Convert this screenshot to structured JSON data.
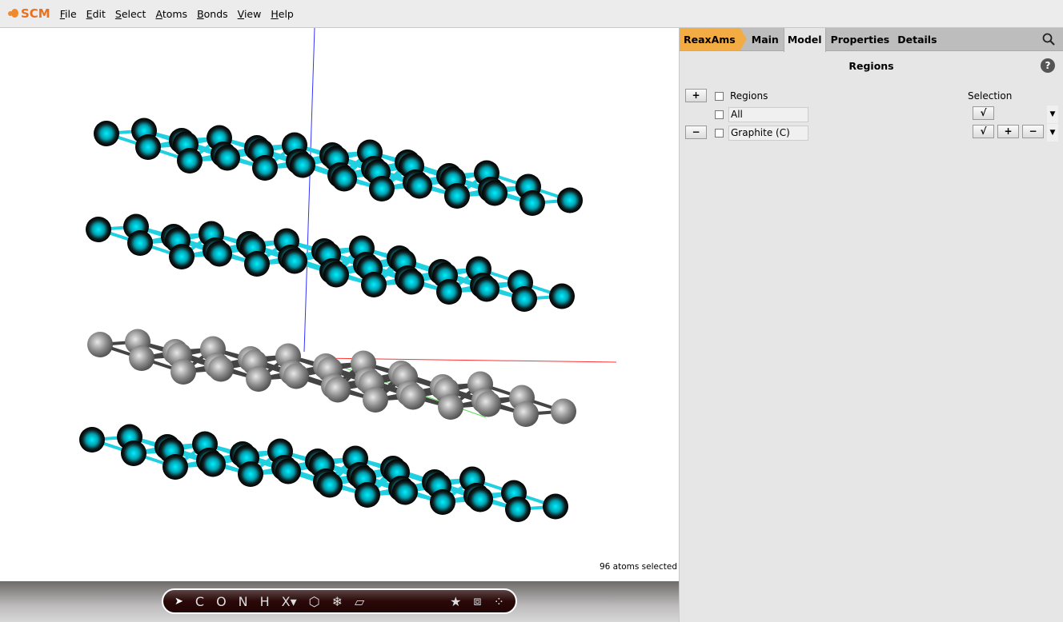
{
  "menubar": {
    "logo": "SCM",
    "items": [
      "File",
      "Edit",
      "Select",
      "Atoms",
      "Bonds",
      "View",
      "Help"
    ]
  },
  "viewer": {
    "status": "96 atoms selected",
    "colors": {
      "selected_atom": "#00e5f0",
      "atom": "#9a9a9a",
      "x_axis": "#ff0000",
      "y_axis": "#00cc00",
      "z_axis": "#0000ff"
    }
  },
  "toolbar": {
    "tools": [
      {
        "icon": "pointer-icon",
        "label": "➤"
      },
      {
        "icon": "carbon",
        "label": "C"
      },
      {
        "icon": "oxygen",
        "label": "O"
      },
      {
        "icon": "nitrogen",
        "label": "N"
      },
      {
        "icon": "hydrogen",
        "label": "H"
      },
      {
        "icon": "other-element",
        "label": "X▾"
      },
      {
        "icon": "hexagon-icon",
        "label": "⬡"
      },
      {
        "icon": "snowflake-icon",
        "label": "❄"
      },
      {
        "icon": "plane-icon",
        "label": "▱"
      }
    ],
    "right_tools": [
      {
        "icon": "star-icon",
        "label": "★"
      },
      {
        "icon": "cube-icon",
        "label": "⧈"
      },
      {
        "icon": "dots-icon",
        "label": "⁘"
      }
    ]
  },
  "panel": {
    "tabs": [
      "ReaxAms",
      "Main",
      "Model",
      "Properties",
      "Details"
    ],
    "active_tab": "Model",
    "title": "Regions",
    "help": "?",
    "header_label": "Regions",
    "selection_label": "Selection",
    "add_label": "+",
    "remove_label": "−",
    "check_label": "√",
    "plus_label": "+",
    "minus_label": "−",
    "dropdown": "▼",
    "regions": [
      "All",
      "Graphite (C)"
    ]
  }
}
